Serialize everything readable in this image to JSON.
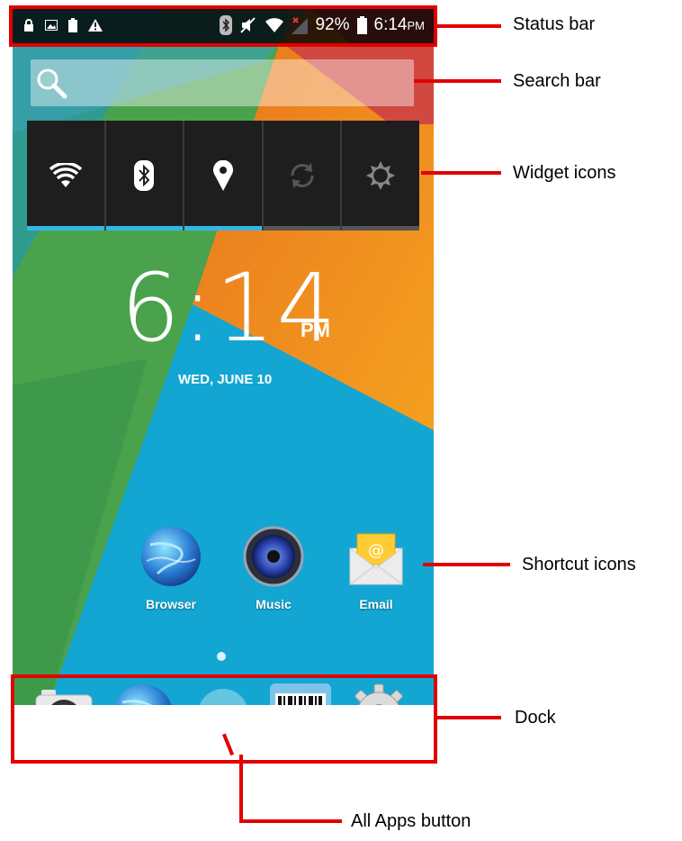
{
  "status_bar": {
    "left_icons": [
      "lock-icon",
      "image-icon",
      "battery-small-icon",
      "warning-icon"
    ],
    "right_icons": [
      "bluetooth-icon",
      "mute-icon",
      "wifi-icon",
      "no-signal-icon"
    ],
    "battery_percent": "92%",
    "time": "6:14",
    "ampm": "PM"
  },
  "search_bar": {
    "icon": "search-icon"
  },
  "widget": {
    "toggles": [
      {
        "name": "wifi-toggle",
        "icon": "wifi-icon",
        "active": true
      },
      {
        "name": "bluetooth-toggle",
        "icon": "bluetooth-icon",
        "active": true
      },
      {
        "name": "location-toggle",
        "icon": "location-pin-icon",
        "active": true
      },
      {
        "name": "sync-toggle",
        "icon": "sync-icon",
        "active": false
      },
      {
        "name": "brightness-toggle",
        "icon": "brightness-icon",
        "active": false
      }
    ],
    "active_color": "#33b5e5",
    "inactive_color": "#555555"
  },
  "clock": {
    "time": "6:14",
    "ampm": "PM",
    "date": "WED, JUNE 10"
  },
  "shortcuts": [
    {
      "label": "Browser",
      "icon": "browser-globe-icon"
    },
    {
      "label": "Music",
      "icon": "music-speaker-icon"
    },
    {
      "label": "Email",
      "icon": "email-envelope-icon"
    }
  ],
  "dock": {
    "items": [
      "camera-icon",
      "browser-globe-icon",
      "all-apps-icon",
      "barcode-scanner-icon",
      "settings-gear-icon"
    ]
  },
  "annotations": {
    "status_bar": "Status bar",
    "search_bar": "Search bar",
    "widget_icons": "Widget icons",
    "shortcut_icons": "Shortcut icons",
    "dock": "Dock",
    "all_apps": "All Apps button"
  },
  "colors": {
    "annotation_red": "#e20000",
    "wallpaper_blue": "#12a0c8",
    "wallpaper_orange": "#f08a1c",
    "wallpaper_red": "#d4473d",
    "wallpaper_green": "#4caf50"
  }
}
